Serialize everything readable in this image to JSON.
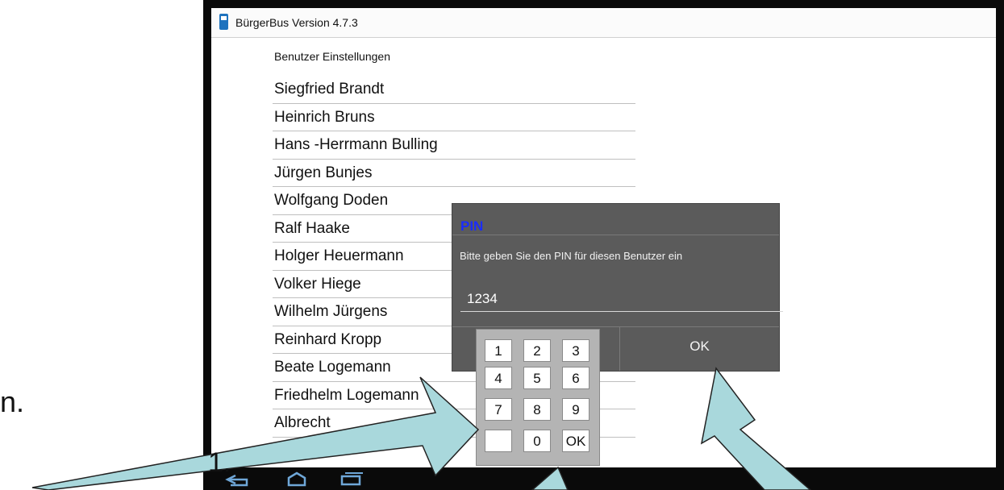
{
  "side_text": "n.",
  "app": {
    "title": "BürgerBus Version 4.7.3",
    "section_title": "Benutzer Einstellungen"
  },
  "users": [
    "Siegfried Brandt",
    "Heinrich Bruns",
    "Hans -Herrmann Bulling",
    "Jürgen Bunjes",
    "Wolfgang Doden",
    "Ralf Haake",
    "Holger Heuermann",
    "Volker Hiege",
    "Wilhelm Jürgens",
    "Reinhard Kropp",
    "Beate Logemann",
    "Friedhelm Logemann",
    "Albrecht"
  ],
  "dialog": {
    "title": "PIN",
    "message": "Bitte geben Sie den PIN für diesen Benutzer ein",
    "pin_value": "1234",
    "ok_label": "OK"
  },
  "keypad": {
    "keys": [
      "1",
      "2",
      "3",
      "4",
      "5",
      "6",
      "7",
      "8",
      "9",
      "",
      "0",
      "OK"
    ]
  },
  "annotation": {
    "arrow_label": "1."
  },
  "nav_icons": [
    "back-icon",
    "home-icon",
    "recent-apps-icon"
  ],
  "colors": {
    "arrow_fill": "#a9d8dc",
    "dialog_bg": "#5b5b5b",
    "dialog_title": "#1a2cff"
  }
}
